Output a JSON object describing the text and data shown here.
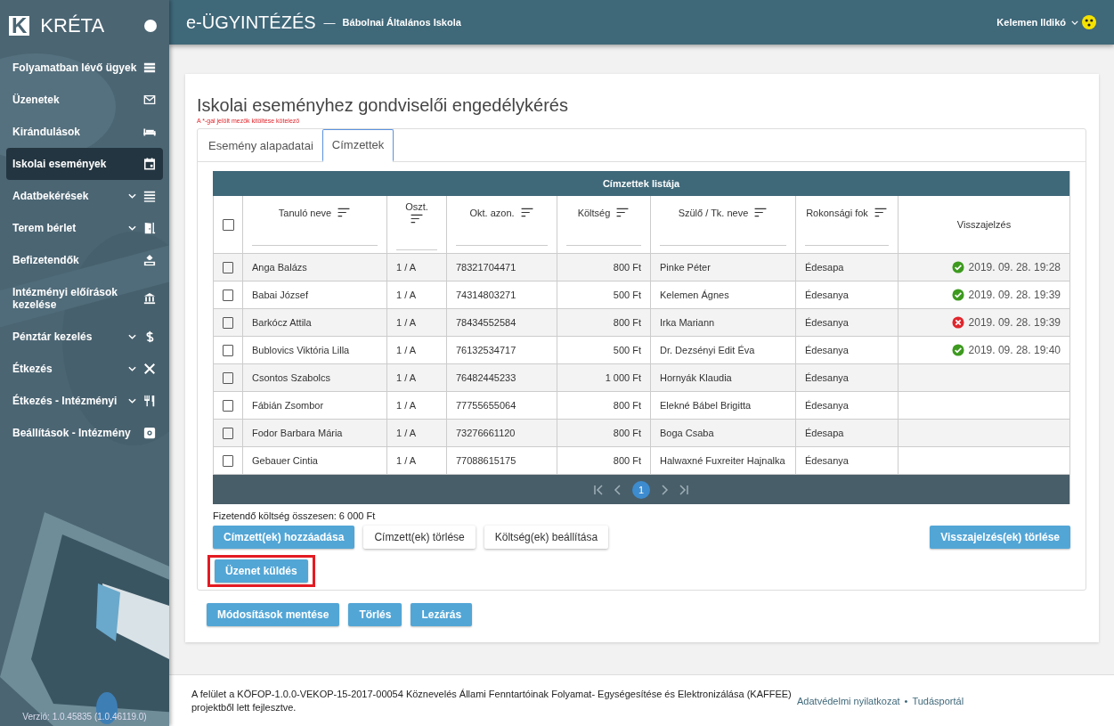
{
  "sidebar": {
    "logo_mark": "K",
    "logo": "KRÉTA",
    "items": [
      {
        "label": "Folyamatban lévő ügyek",
        "expandable": false,
        "selected": false
      },
      {
        "label": "Üzenetek",
        "expandable": false,
        "selected": false
      },
      {
        "label": "Kirándulások",
        "expandable": false,
        "selected": false
      },
      {
        "label": "Iskolai események",
        "expandable": false,
        "selected": true
      },
      {
        "label": "Adatbekérések",
        "expandable": true,
        "selected": false
      },
      {
        "label": "Terem bérlet",
        "expandable": true,
        "selected": false
      },
      {
        "label": "Befizetendők",
        "expandable": false,
        "selected": false
      },
      {
        "label": "Intézményi előírások kezelése",
        "expandable": false,
        "selected": false
      },
      {
        "label": "Pénztár kezelés",
        "expandable": true,
        "selected": false
      },
      {
        "label": "Étkezés",
        "expandable": true,
        "selected": false
      },
      {
        "label": "Étkezés - Intézményi",
        "expandable": true,
        "selected": false
      },
      {
        "label": "Beállítások - Intézmény",
        "expandable": false,
        "selected": false
      }
    ],
    "version": "Verzió: 1.0.45835 (1.0.46119.0)"
  },
  "header": {
    "title": "e-ÜGYINTÉZÉS",
    "separator": "—",
    "school": "Bábolnai Általános Iskola",
    "user": "Kelemen Ildikó"
  },
  "page": {
    "title": "Iskolai eseményhez gondviselői engedélykérés",
    "required_note": "A *-gal jelölt mezők kitöltése kötelező",
    "tabs": [
      {
        "label": "Esemény alapadatai",
        "selected": false
      },
      {
        "label": "Címzettek",
        "selected": true
      }
    ]
  },
  "table": {
    "title": "Címzettek listája",
    "select_all": {
      "checked": false
    },
    "columns": [
      {
        "label": "Tanuló neve",
        "sortable": true
      },
      {
        "label": "Oszt.",
        "sortable": true
      },
      {
        "label": "Okt. azon.",
        "sortable": true
      },
      {
        "label": "Költség",
        "sortable": true
      },
      {
        "label": "Szülő / Tk. neve",
        "sortable": true
      },
      {
        "label": "Rokonsági fok",
        "sortable": true
      },
      {
        "label": "Visszajelzés",
        "sortable": false
      }
    ],
    "rows": [
      {
        "checked": false,
        "name": "Anga Balázs",
        "class": "1 / A",
        "id": "78321704471",
        "cost": "800 Ft",
        "parent": "Pinke Péter",
        "relation": "Édesapa",
        "feedback": {
          "accepted": true,
          "time": "2019. 09. 28. 19:28"
        }
      },
      {
        "checked": false,
        "name": "Babai József",
        "class": "1 / A",
        "id": "74314803271",
        "cost": "500 Ft",
        "parent": "Kelemen Ágnes",
        "relation": "Édesanya",
        "feedback": {
          "accepted": true,
          "time": "2019. 09. 28. 19:39"
        }
      },
      {
        "checked": false,
        "name": "Barkócz Attila",
        "class": "1 / A",
        "id": "78434552584",
        "cost": "800 Ft",
        "parent": "Irka Mariann",
        "relation": "Édesanya",
        "feedback": {
          "accepted": false,
          "time": "2019. 09. 28. 19:39"
        }
      },
      {
        "checked": false,
        "name": "Bublovics Viktória Lilla",
        "class": "1 / A",
        "id": "76132534717",
        "cost": "500 Ft",
        "parent": "Dr. Dezsényi Edit Éva",
        "relation": "Édesanya",
        "feedback": {
          "accepted": true,
          "time": "2019. 09. 28. 19:40"
        }
      },
      {
        "checked": false,
        "name": "Csontos Szabolcs",
        "class": "1 / A",
        "id": "76482445233",
        "cost": "1 000 Ft",
        "parent": "Hornyák Klaudia",
        "relation": "Édesanya"
      },
      {
        "checked": false,
        "name": "Fábián Zsombor",
        "class": "1 / A",
        "id": "77755655064",
        "cost": "800 Ft",
        "parent": "Elekné Bábel Brigitta",
        "relation": "Édesanya"
      },
      {
        "checked": false,
        "name": "Fodor Barbara Mária",
        "class": "1 / A",
        "id": "73276661120",
        "cost": "800 Ft",
        "parent": "Boga Csaba",
        "relation": "Édesapa"
      },
      {
        "checked": false,
        "name": "Gebauer Cintia",
        "class": "1 / A",
        "id": "77088615175",
        "cost": "800 Ft",
        "parent": "Halwaxné Fuxreiter Hajnalka",
        "relation": "Édesanya"
      }
    ],
    "pages": [
      {
        "label": "1",
        "selected": true
      }
    ]
  },
  "total": "Fizetendő költség összesen: 6 000 Ft",
  "actions": [
    {
      "label": "Címzett(ek) hozzáadása",
      "kind": "primary",
      "highlighted": false
    },
    {
      "label": "Címzett(ek) törlése",
      "kind": "secondary",
      "highlighted": false
    },
    {
      "label": "Költség(ek) beállítása",
      "kind": "secondary",
      "highlighted": false
    },
    {
      "label": "Visszajelzés(ek) törlése",
      "kind": "primary-right",
      "highlighted": false
    },
    {
      "label": "Üzenet küldés",
      "kind": "primary-newline",
      "highlighted": true
    }
  ],
  "form_buttons": [
    "Módosítások mentése",
    "Törlés",
    "Lezárás"
  ],
  "footer": {
    "text": "A felület a KÖFOP-1.0.0-VEKOP-15-2017-00054 Köznevelés Állami Fenntartóinak Folyamat- Egységesítése és Elektronizálása (KAFFEE) projektből lett fejlesztve.",
    "links": [
      "Adatvédelmi nyilatkozat",
      "Tudásportál"
    ],
    "link_separator": "•"
  }
}
